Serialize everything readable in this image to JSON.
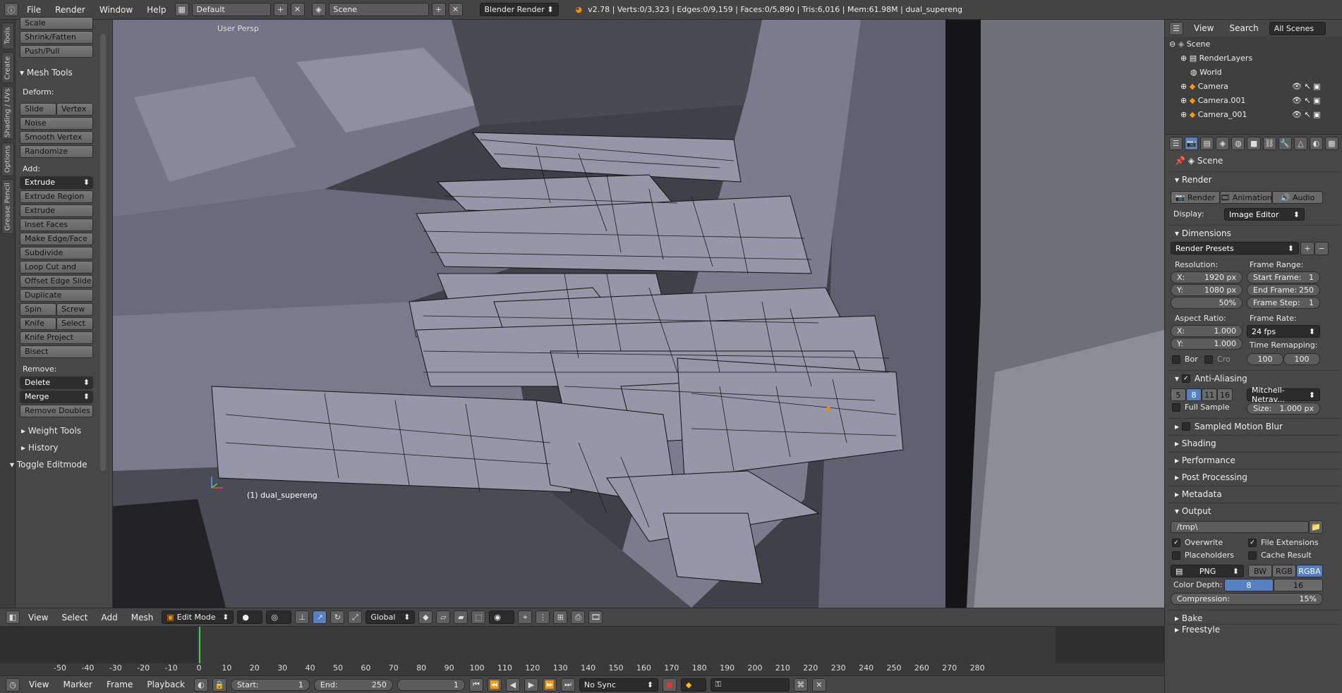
{
  "topbar": {
    "menus": [
      "File",
      "Render",
      "Window",
      "Help"
    ],
    "layout": "Default",
    "scene": "Scene",
    "engine": "Blender Render",
    "stats": "v2.78 | Verts:0/3,323 | Edges:0/9,159 | Faces:0/5,890 | Tris:6,016 | Mem:61.98M | dual_supereng"
  },
  "vtabs": [
    "Tools",
    "Create",
    "Shading / UVs",
    "Options",
    "Grease Pencil"
  ],
  "toolpanel": {
    "top_buttons": [
      "Scale",
      "Shrink/Fatten",
      "Push/Pull"
    ],
    "mesh_tools_header": "Mesh Tools",
    "deform_label": "Deform:",
    "slide_edge": "Slide Ed",
    "vertex": "Vertex",
    "noise": "Noise",
    "smooth_vertex": "Smooth Vertex",
    "randomize": "Randomize",
    "add_label": "Add:",
    "extrude": "Extrude",
    "extrude_region": "Extrude Region",
    "extrude_individual": "Extrude Individual",
    "inset_faces": "Inset Faces",
    "make_edge_face": "Make Edge/Face",
    "subdivide": "Subdivide",
    "loop_cut": "Loop Cut and Slide",
    "offset_edge": "Offset Edge Slide",
    "duplicate": "Duplicate",
    "spin": "Spin",
    "screw": "Screw",
    "knife": "Knife",
    "select": "Select",
    "knife_project": "Knife Project",
    "bisect": "Bisect",
    "remove_label": "Remove:",
    "delete": "Delete",
    "merge": "Merge",
    "remove_doubles": "Remove Doubles",
    "weight_tools": "Weight Tools",
    "history": "History",
    "toggle_editmode": "Toggle Editmode"
  },
  "viewport": {
    "view_label": "User Persp",
    "object_label": "(1) dual_supereng"
  },
  "viewport_header": {
    "menus": [
      "View",
      "Select",
      "Add",
      "Mesh"
    ],
    "mode": "Edit Mode",
    "orientation": "Global"
  },
  "timeline": {
    "ticks": [
      "-50",
      "-40",
      "-30",
      "-20",
      "-10",
      "0",
      "10",
      "20",
      "30",
      "40",
      "50",
      "60",
      "70",
      "80",
      "90",
      "100",
      "110",
      "120",
      "130",
      "140",
      "150",
      "160",
      "170",
      "180",
      "190",
      "200",
      "210",
      "220",
      "230",
      "240",
      "250",
      "260",
      "270",
      "280"
    ],
    "current_frame": 1,
    "menus": [
      "View",
      "Marker",
      "Frame",
      "Playback"
    ],
    "start_label": "Start:",
    "start": "1",
    "end_label": "End:",
    "end": "250",
    "frame": "1",
    "sync": "No Sync"
  },
  "outliner": {
    "menus": [
      "View",
      "Search"
    ],
    "filter": "All Scenes",
    "items": [
      "Scene",
      "RenderLayers",
      "World",
      "Camera",
      "Camera.001",
      "Camera_001"
    ]
  },
  "properties": {
    "context": "Scene",
    "render_header": "Render",
    "render_btn": "Render",
    "animation_btn": "Animation",
    "audio_btn": "Audio",
    "display_label": "Display:",
    "display_value": "Image Editor",
    "dimensions_header": "Dimensions",
    "render_presets": "Render Presets",
    "resolution_label": "Resolution:",
    "res_x_label": "X:",
    "res_x": "1920 px",
    "res_y_label": "Y:",
    "res_y": "1080 px",
    "res_pct": "50%",
    "frame_range_label": "Frame Range:",
    "start_frame_label": "Start Frame:",
    "start_frame": "1",
    "end_frame_label": "End Frame:",
    "end_frame": "250",
    "frame_step_label": "Frame Step:",
    "frame_step": "1",
    "aspect_label": "Aspect Ratio:",
    "aspect_x": "1.000",
    "aspect_y": "1.000",
    "frame_rate_label": "Frame Rate:",
    "frame_rate": "24 fps",
    "time_remap_label": "Time Remapping:",
    "remap_old": "100",
    "remap_new": "100",
    "border": "Bor",
    "crop": "Cro",
    "aa_header": "Anti-Aliasing",
    "aa_samples": [
      "5",
      "8",
      "11",
      "16"
    ],
    "aa_selected": "8",
    "aa_filter": "Mitchell-Netrav...",
    "full_sample": "Full Sample",
    "size_label": "Size:",
    "size": "1.000 px",
    "motion_blur": "Sampled Motion Blur",
    "shading": "Shading",
    "performance": "Performance",
    "post_processing": "Post Processing",
    "metadata": "Metadata",
    "output_header": "Output",
    "output_path": "/tmp\\",
    "overwrite": "Overwrite",
    "file_extensions": "File Extensions",
    "placeholders": "Placeholders",
    "cache_result": "Cache Result",
    "format": "PNG",
    "bw": "BW",
    "rgb": "RGB",
    "rgba": "RGBA",
    "color_depth_label": "Color Depth:",
    "depth_8": "8",
    "depth_16": "16",
    "compression_label": "Compression:",
    "compression": "15%",
    "bake": "Bake",
    "freestyle": "Freestyle"
  }
}
